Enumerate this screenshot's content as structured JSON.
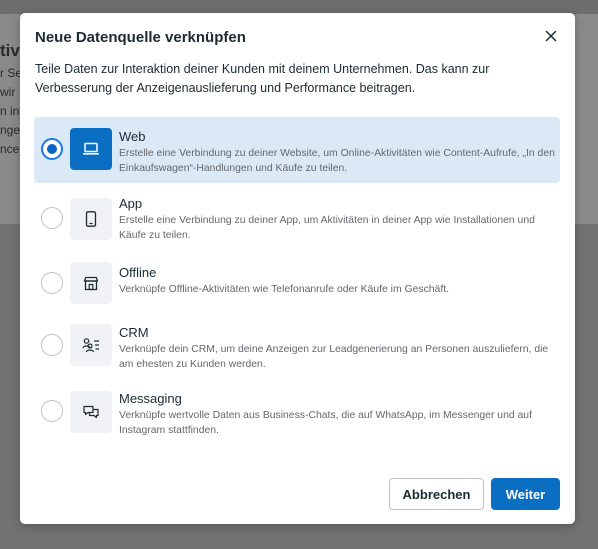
{
  "background": {
    "heading_fragment": "tiv",
    "lines": [
      "r Se",
      "wir",
      "n int",
      "nger",
      "nce."
    ]
  },
  "dialog": {
    "title": "Neue Datenquelle verknüpfen",
    "intro": "Teile Daten zur Interaktion deiner Kunden mit deinem Unternehmen. Das kann zur Verbesserung der Anzeigenauslieferung und Performance beitragen.",
    "options": [
      {
        "title": "Web",
        "description": "Erstelle eine Verbindung zu deiner Website, um Online-Aktivitäten wie Content-Aufrufe, „In den Einkaufswagen“-Handlungen und Käufe zu teilen.",
        "icon": "laptop-icon",
        "selected": true
      },
      {
        "title": "App",
        "description": "Erstelle eine Verbindung zu deiner App, um Aktivitäten in deiner App wie Installationen und Käufe zu teilen.",
        "icon": "mobile-phone-icon",
        "selected": false
      },
      {
        "title": "Offline",
        "description": "Verknüpfe Offline-Aktivitäten wie Telefonanrufe oder Käufe im Geschäft.",
        "icon": "store-icon",
        "selected": false
      },
      {
        "title": "CRM",
        "description": "Verknüpfe dein CRM, um deine Anzeigen zur Leadgenerierung an Personen auszuliefern, die am ehesten zu Kunden werden.",
        "icon": "people-list-icon",
        "selected": false
      },
      {
        "title": "Messaging",
        "description": "Verknüpfe wertvolle Daten aus Business-Chats, die auf WhatsApp, im Messenger und auf Instagram stattfinden.",
        "icon": "chat-bubbles-icon",
        "selected": false
      }
    ],
    "cancel_label": "Abbrechen",
    "next_label": "Weiter"
  },
  "colors": {
    "accent": "#0a6fc2",
    "selected_bg": "#dbe9f6",
    "text": "#1c2b33",
    "muted": "#65676b"
  }
}
